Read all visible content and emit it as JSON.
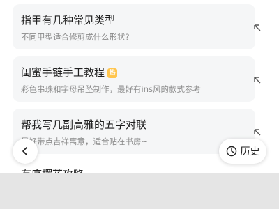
{
  "suggestions": [
    {
      "title": "指甲有几种常见类型",
      "subtitle": "不同甲型适合修剪成什么形状?",
      "hot": false
    },
    {
      "title": "闺蜜手链手工教程",
      "subtitle": "彩色串珠和字母吊坠制作，最好有ins风的款式参考",
      "hot": true,
      "hot_label": "热"
    },
    {
      "title": "帮我写几副高雅的五字对联",
      "subtitle": "最好带点吉祥寓意，适合贴在书房~",
      "hot": false
    },
    {
      "title": "有序摆花攻略",
      "hot": false
    }
  ],
  "buttons": {
    "history_label": "历史"
  },
  "icons": {
    "fill_arrow": "arrow-up-left-icon",
    "back": "chevron-left-icon",
    "history": "clock-icon"
  }
}
